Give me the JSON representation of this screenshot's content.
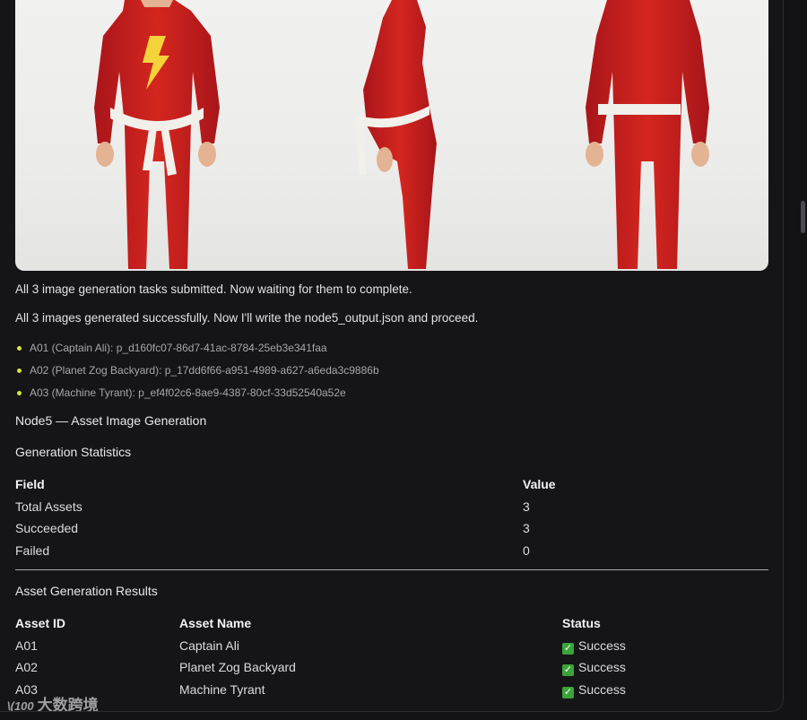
{
  "messages": {
    "submitted": "All 3 image generation tasks submitted. Now waiting for them to complete.",
    "generated": "All 3 images generated successfully. Now I'll write the node5_output.json and proceed."
  },
  "asset_list": [
    "A01 (Captain Ali): p_d160fc07-86d7-41ac-8784-25eb3e341faa",
    "A02 (Planet Zog Backyard): p_17dd6f66-a951-4989-a627-a6eda3c9886b",
    "A03 (Machine Tyrant): p_ef4f02c6-8ae9-4387-80cf-33d52540a52e"
  ],
  "node_title": "Node5 — Asset Image Generation",
  "stats": {
    "title": "Generation Statistics",
    "headers": [
      "Field",
      "Value"
    ],
    "rows": [
      [
        "Total Assets",
        "3"
      ],
      [
        "Succeeded",
        "3"
      ],
      [
        "Failed",
        "0"
      ]
    ]
  },
  "results": {
    "title": "Asset Generation Results",
    "headers": [
      "Asset ID",
      "Asset Name",
      "Status"
    ],
    "rows": [
      [
        "A01",
        "Captain Ali",
        "Success"
      ],
      [
        "A02",
        "Planet Zog Backyard",
        "Success"
      ],
      [
        "A03",
        "Machine Tyrant",
        "Success"
      ]
    ]
  },
  "watermark": "大数跨境",
  "colors": {
    "background": "#151518",
    "bullet": "#d6e83a",
    "success_check": "#3aa43a",
    "suit_red": "#c8201f"
  }
}
